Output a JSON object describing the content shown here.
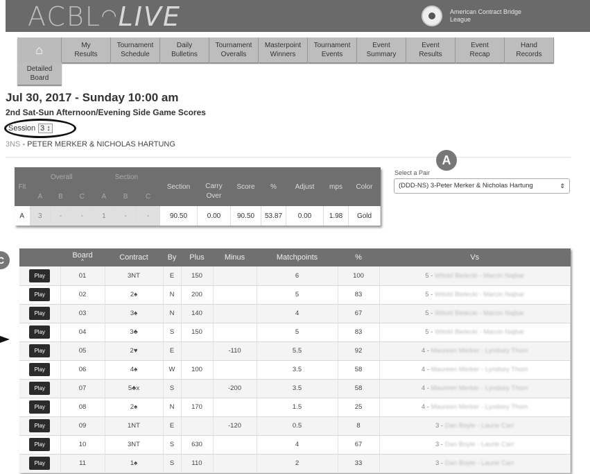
{
  "header": {
    "logo_acbl": "ACBL",
    "logo_live": "LIVE",
    "org_name": "American Contract Bridge League"
  },
  "nav": {
    "home_icon": "home-icon",
    "items": [
      {
        "label": "My\nResults"
      },
      {
        "label": "Tournament\nSchedule"
      },
      {
        "label": "Daily\nBulletins"
      },
      {
        "label": "Tournament\nOveralls"
      },
      {
        "label": "Masterpoint\nWinners"
      },
      {
        "label": "Tournament\nEvents"
      },
      {
        "label": "Event\nSummary"
      },
      {
        "label": "Event\nResults"
      },
      {
        "label": "Event\nRecap"
      },
      {
        "label": "Hand\nRecords"
      }
    ],
    "detailed_board": "Detailed\nBoard"
  },
  "event": {
    "date": "Jul 30, 2017 - Sunday 10:00 am",
    "title": "2nd Sat-Sun Afternoon/Evening Side Game Scores",
    "session_label": "Session",
    "session_value": "3 ↕",
    "pair_code": "3NS",
    "pair_names": " - PETER MERKER & NICHOLAS HARTUNG"
  },
  "summary": {
    "headers": {
      "flt": "Flt",
      "overall": "Overall",
      "section_group": "Section",
      "a": "A",
      "b": "B",
      "c": "C",
      "section": "Section",
      "carry_over": "Carry\nOver",
      "score": "Score",
      "pct": "%",
      "adjust": "Adjust",
      "mps": "mps",
      "color": "Color"
    },
    "row": {
      "flt": "A",
      "oa": "3",
      "ob": "-",
      "oc": "-",
      "sa": "1",
      "sb": "-",
      "sc": "-",
      "section": "90.50",
      "carry": "0.00",
      "score": "90.50",
      "pct": "53.87",
      "adjust": "0.00",
      "mps": "1.98",
      "color": "Gold"
    }
  },
  "pair_select": {
    "label": "Select a Pair",
    "value": "(DDD-NS) 3-Peter Merker & Nicholas Hartung"
  },
  "badges": {
    "a": "A",
    "c": "C"
  },
  "results": {
    "headers": {
      "board": "Board",
      "contract": "Contract",
      "by": "By",
      "plus": "Plus",
      "minus": "Minus",
      "matchpoints": "Matchpoints",
      "pct": "%",
      "vs": "Vs"
    },
    "play_label": "Play",
    "rows": [
      {
        "board": "01",
        "contract": "3NT",
        "by": "E",
        "plus": "150",
        "minus": "",
        "mp": "6",
        "pct": "100",
        "vs_num": "5 - ",
        "vs_names": "Witold Bielecki - Marcin Najbar"
      },
      {
        "board": "02",
        "contract": "2♠",
        "by": "N",
        "plus": "200",
        "minus": "",
        "mp": "5",
        "pct": "83",
        "vs_num": "5 - ",
        "vs_names": "Witold Bielecki - Marcin Najbar"
      },
      {
        "board": "03",
        "contract": "3♠",
        "by": "N",
        "plus": "140",
        "minus": "",
        "mp": "4",
        "pct": "67",
        "vs_num": "5 - ",
        "vs_names": "Witold Bielecki - Marcin Najbar"
      },
      {
        "board": "04",
        "contract": "3♣",
        "by": "S",
        "plus": "150",
        "minus": "",
        "mp": "5",
        "pct": "83",
        "vs_num": "5 - ",
        "vs_names": "Witold Bielecki - Marcin Najbar"
      },
      {
        "board": "05",
        "contract": "2♥",
        "by": "E",
        "plus": "",
        "minus": "-110",
        "mp": "5.5",
        "pct": "92",
        "vs_num": "4 - ",
        "vs_names": "Maureen Merker - Lyndsey Thom"
      },
      {
        "board": "06",
        "contract": "4♠",
        "by": "W",
        "plus": "100",
        "minus": "",
        "mp": "3.5",
        "pct": "58",
        "vs_num": "4 - ",
        "vs_names": "Maureen Merker - Lyndsey Thom"
      },
      {
        "board": "07",
        "contract": "5♣x",
        "by": "S",
        "plus": "",
        "minus": "-200",
        "mp": "3.5",
        "pct": "58",
        "vs_num": "4 - ",
        "vs_names": "Maureen Merker - Lyndsey Thom"
      },
      {
        "board": "08",
        "contract": "2♠",
        "by": "N",
        "plus": "170",
        "minus": "",
        "mp": "1.5",
        "pct": "25",
        "vs_num": "4 - ",
        "vs_names": "Maureen Merker - Lyndsey Thom"
      },
      {
        "board": "09",
        "contract": "1NT",
        "by": "E",
        "plus": "",
        "minus": "-120",
        "mp": "0.5",
        "pct": "8",
        "vs_num": "3 - ",
        "vs_names": "Dan Boyle - Laurie Carr"
      },
      {
        "board": "10",
        "contract": "3NT",
        "by": "S",
        "plus": "630",
        "minus": "",
        "mp": "4",
        "pct": "67",
        "vs_num": "3 - ",
        "vs_names": "Dan Boyle - Laurie Carr"
      },
      {
        "board": "11",
        "contract": "1♠",
        "by": "S",
        "plus": "110",
        "minus": "",
        "mp": "2",
        "pct": "33",
        "vs_num": "3 - ",
        "vs_names": "Dan Boyle - Laurie Carr"
      }
    ]
  }
}
